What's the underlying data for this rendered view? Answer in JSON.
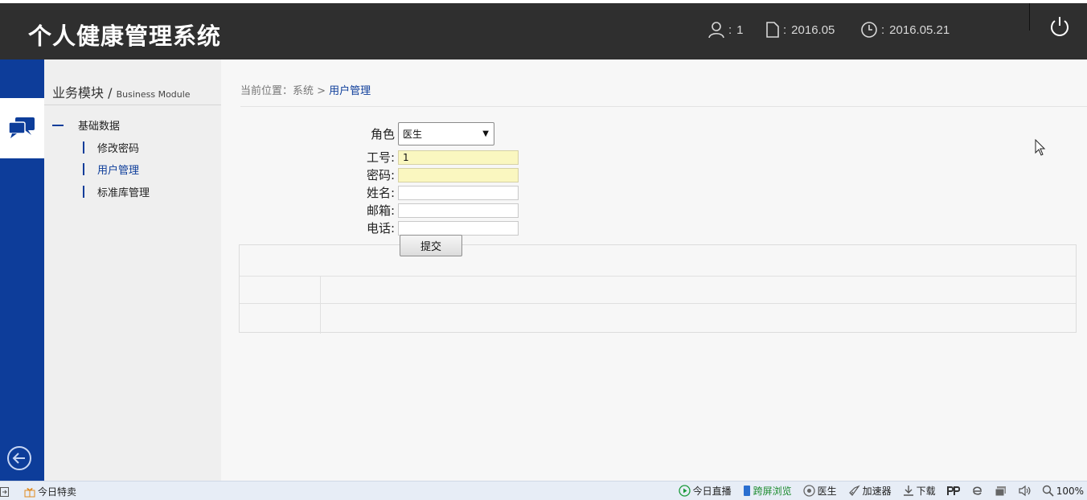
{
  "header": {
    "title": "个人健康管理系统",
    "user_value": "1",
    "period_value": "2016.05",
    "date_value": "2016.05.21",
    "separator": ":"
  },
  "sidebar": {
    "title": "业务模块",
    "title_en": "Business Module",
    "title_sep": " / ",
    "group_label": "基础数据",
    "items": [
      {
        "label": "修改密码",
        "active": false
      },
      {
        "label": "用户管理",
        "active": true
      },
      {
        "label": "标准库管理",
        "active": false
      }
    ]
  },
  "breadcrumb": {
    "prefix": "当前位置：系统 > ",
    "current": "用户管理"
  },
  "form": {
    "role_label": "角色",
    "role_value": "医生",
    "id_label": "工号:",
    "id_value": "1",
    "password_label": "密码:",
    "password_value": "",
    "name_label": "姓名:",
    "name_value": "",
    "email_label": "邮箱:",
    "email_value": "",
    "phone_label": "电话:",
    "phone_value": "",
    "submit_label": "提交"
  },
  "statusbar": {
    "deal_label": "今日特卖",
    "live_label": "今日直播",
    "cross_label": "跨屏浏览",
    "doctor_label": "医生",
    "accel_label": "加速器",
    "download_label": "下载",
    "zoom_label": "100%"
  },
  "colors": {
    "header_bg": "#2f2f2f",
    "brand_blue": "#0d3d9a",
    "filled_input": "#faf7c0"
  }
}
